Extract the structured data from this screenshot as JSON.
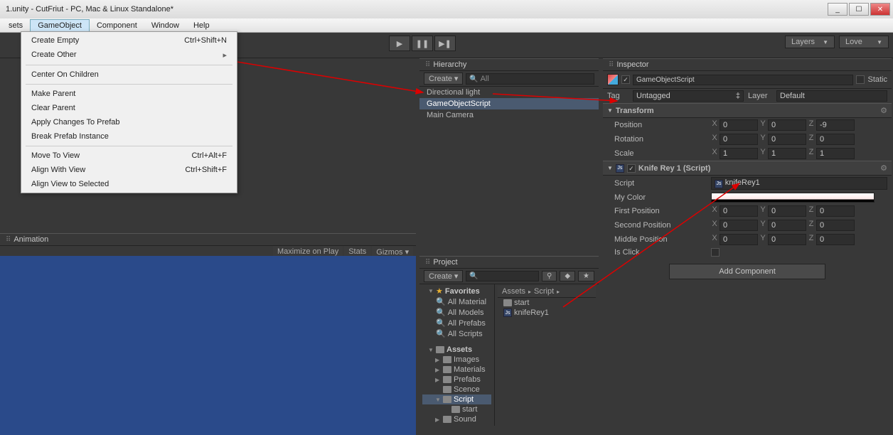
{
  "title": "1.unity - CutFriut - PC, Mac & Linux Standalone*",
  "menubar": [
    "sets",
    "GameObject",
    "Component",
    "Window",
    "Help"
  ],
  "dropdown": {
    "g1": [
      {
        "label": "Create Empty",
        "shortcut": "Ctrl+Shift+N"
      },
      {
        "label": "Create Other",
        "shortcut": "▸"
      }
    ],
    "g2": [
      {
        "label": "Center On Children",
        "shortcut": ""
      }
    ],
    "g3": [
      {
        "label": "Make Parent",
        "shortcut": ""
      },
      {
        "label": "Clear Parent",
        "shortcut": ""
      },
      {
        "label": "Apply Changes To Prefab",
        "shortcut": ""
      },
      {
        "label": "Break Prefab Instance",
        "shortcut": ""
      }
    ],
    "g4": [
      {
        "label": "Move To View",
        "shortcut": "Ctrl+Alt+F"
      },
      {
        "label": "Align With View",
        "shortcut": "Ctrl+Shift+F"
      },
      {
        "label": "Align View to Selected",
        "shortcut": ""
      }
    ]
  },
  "toolbar_right": {
    "layers": "Layers",
    "layout": "Love"
  },
  "hierarchy": {
    "tab": "Hierarchy",
    "create": "Create",
    "search": "All",
    "items": [
      "Directional light",
      "GameObjectScript",
      "Main Camera"
    ]
  },
  "inspector": {
    "tab": "Inspector",
    "static": "Static",
    "name": "GameObjectScript",
    "tag_label": "Tag",
    "tag_value": "Untagged",
    "layer_label": "Layer",
    "layer_value": "Default",
    "transform": {
      "title": "Transform",
      "position": {
        "label": "Position",
        "x": "0",
        "y": "0",
        "z": "-9"
      },
      "rotation": {
        "label": "Rotation",
        "x": "0",
        "y": "0",
        "z": "0"
      },
      "scale": {
        "label": "Scale",
        "x": "1",
        "y": "1",
        "z": "1"
      }
    },
    "script_comp": {
      "title": "Knife Rey 1 (Script)",
      "script_label": "Script",
      "script_value": "knifeRey1",
      "mycolor": "My Color",
      "first": {
        "label": "First Position",
        "x": "0",
        "y": "0",
        "z": "0"
      },
      "second": {
        "label": "Second Position",
        "x": "0",
        "y": "0",
        "z": "0"
      },
      "middle": {
        "label": "Middle Position",
        "x": "0",
        "y": "0",
        "z": "0"
      },
      "isclick": "Is Click"
    },
    "add": "Add Component"
  },
  "project": {
    "tab": "Project",
    "create": "Create",
    "favorites": {
      "title": "Favorites",
      "items": [
        "All Material",
        "All Models",
        "All Prefabs",
        "All Scripts"
      ]
    },
    "assets": {
      "title": "Assets",
      "items": [
        "Images",
        "Materials",
        "Prefabs",
        "Scence",
        "Script",
        "Sound"
      ],
      "script_children": [
        "start"
      ]
    },
    "breadcrumb": [
      "Assets",
      "Script"
    ],
    "right_items": [
      {
        "icon": "folder",
        "name": "start"
      },
      {
        "icon": "js",
        "name": "knifeRey1"
      }
    ]
  },
  "animation": {
    "tab": "Animation"
  },
  "scene_opts": [
    "Maximize on Play",
    "Stats",
    "Gizmos"
  ]
}
